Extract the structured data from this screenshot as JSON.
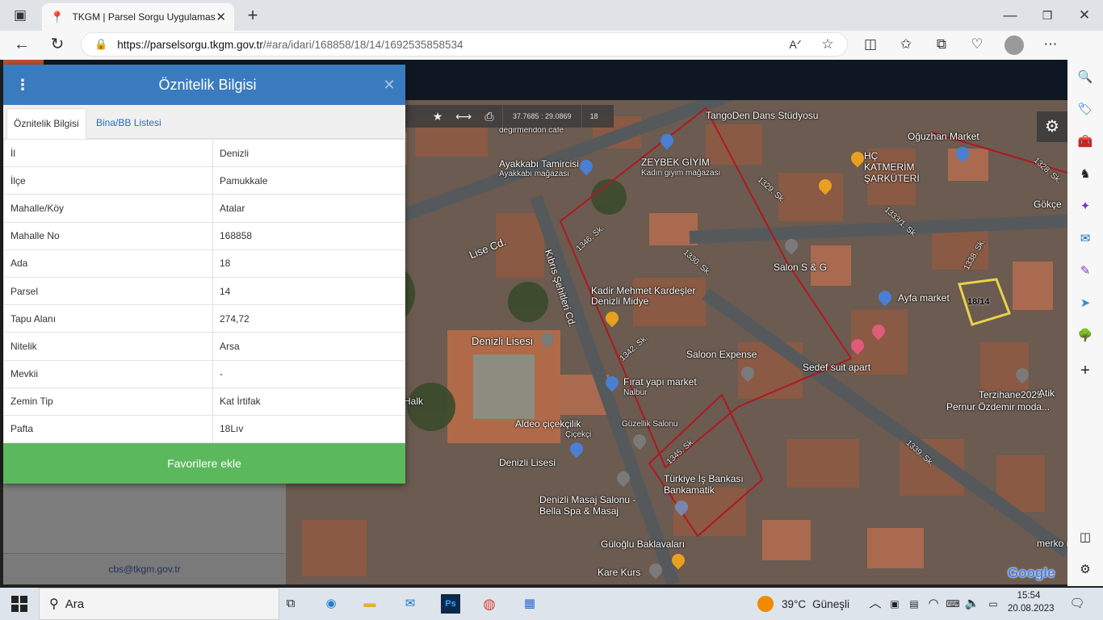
{
  "browser": {
    "tab_title": "TKGM | Parsel Sorgu Uygulaması",
    "new_tab_icon": "plus-icon",
    "url_host": "https://parselsorgu.tkgm.gov.tr",
    "url_path": "/#ara/idari/168858/18/14/1692535858534",
    "window_controls": [
      "minimize-icon",
      "maximize-icon",
      "close-icon"
    ]
  },
  "map": {
    "toolbar": {
      "coords": "37.7685 : 29.0869",
      "zoom": "18"
    },
    "labels": [
      "TangoDen Dans Stüdyosu",
      "Oğuzhan Market",
      "Ayakkabı Tamircisi",
      "Ayakkabı mağazası",
      "ZEYBEK GİYİM",
      "Kadın giyim mağazası",
      "HÇ KATMERİM ŞARKÜTERİ",
      "Lise Cd.",
      "Salon S & G",
      "Kadir Mehmet Kardeşler Denizli Midye",
      "Ayfa market",
      "18/14",
      "Denizli Lisesi",
      "Saloon Expense",
      "Sedef suit apart",
      "Fırat yapı market",
      "Nalbur",
      "Terzihane2025",
      "Pernur Özdemir moda...",
      "Aldeo çiçekçilik",
      "Çiçekçi",
      "Güzellik Salonu",
      "Halk",
      "Denizli Lisesi",
      "Türkiye İş Bankası Bankamatik",
      "Denizli Masaj Salonu - Bella Spa & Masaj",
      "Güloğlu Baklavaları",
      "Kare Kurs",
      "Google",
      "Kıbrıs Şehitleri Cd.",
      "1346. Sk.",
      "1330. Sk.",
      "1329. Sk.",
      "1333/1. Sk.",
      "1338. Sk.",
      "1328. Sk.",
      "1342. Sk.",
      "1345. Sk.",
      "1339. Sk.",
      "Gökçe",
      "degirmendon cafe",
      "merko n",
      "Atik"
    ]
  },
  "left_panel": {
    "footer_email": "cbs@tkgm.gov.tr"
  },
  "modal": {
    "title": "Öznitelik Bilgisi",
    "tabs": [
      "Öznitelik Bilgisi",
      "Bina/BB Listesi"
    ],
    "rows": [
      {
        "key": "İl",
        "value": "Denizli"
      },
      {
        "key": "İlçe",
        "value": "Pamukkale"
      },
      {
        "key": "Mahalle/Köy",
        "value": "Atalar"
      },
      {
        "key": "Mahalle No",
        "value": "168858"
      },
      {
        "key": "Ada",
        "value": "18"
      },
      {
        "key": "Parsel",
        "value": "14"
      },
      {
        "key": "Tapu Alanı",
        "value": "274,72"
      },
      {
        "key": "Nitelik",
        "value": "Arsa"
      },
      {
        "key": "Mevkii",
        "value": "-"
      },
      {
        "key": "Zemin Tip",
        "value": "Kat İrtifak"
      },
      {
        "key": "Pafta",
        "value": "18Lıv"
      }
    ],
    "favorite_button": "Favorilere ekle"
  },
  "taskbar": {
    "search_placeholder": "Ara",
    "weather_temp": "39°C",
    "weather_text": "Güneşli",
    "time": "15:54",
    "date": "20.08.2023"
  },
  "colors": {
    "modal_header": "#3a7bbf",
    "favorite_button": "#5cb85c",
    "parcel_outline": "#e8d24a",
    "boundary_line": "#b01820"
  }
}
